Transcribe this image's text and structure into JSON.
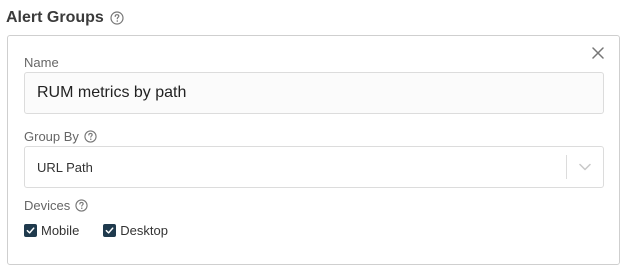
{
  "section": {
    "title": "Alert Groups",
    "help_icon": "question-circle-icon"
  },
  "form": {
    "close_icon": "close-icon",
    "name": {
      "label": "Name",
      "value": "RUM metrics by path"
    },
    "group_by": {
      "label": "Group By",
      "help_icon": "question-circle-icon",
      "selected": "URL Path",
      "arrow_icon": "chevron-down-icon"
    },
    "devices": {
      "label": "Devices",
      "help_icon": "question-circle-icon",
      "options": [
        {
          "label": "Mobile",
          "checked": true
        },
        {
          "label": "Desktop",
          "checked": true
        }
      ]
    }
  },
  "colors": {
    "checkbox": "#1f3a4d",
    "border": "#cfcfcf",
    "label": "#666666"
  }
}
